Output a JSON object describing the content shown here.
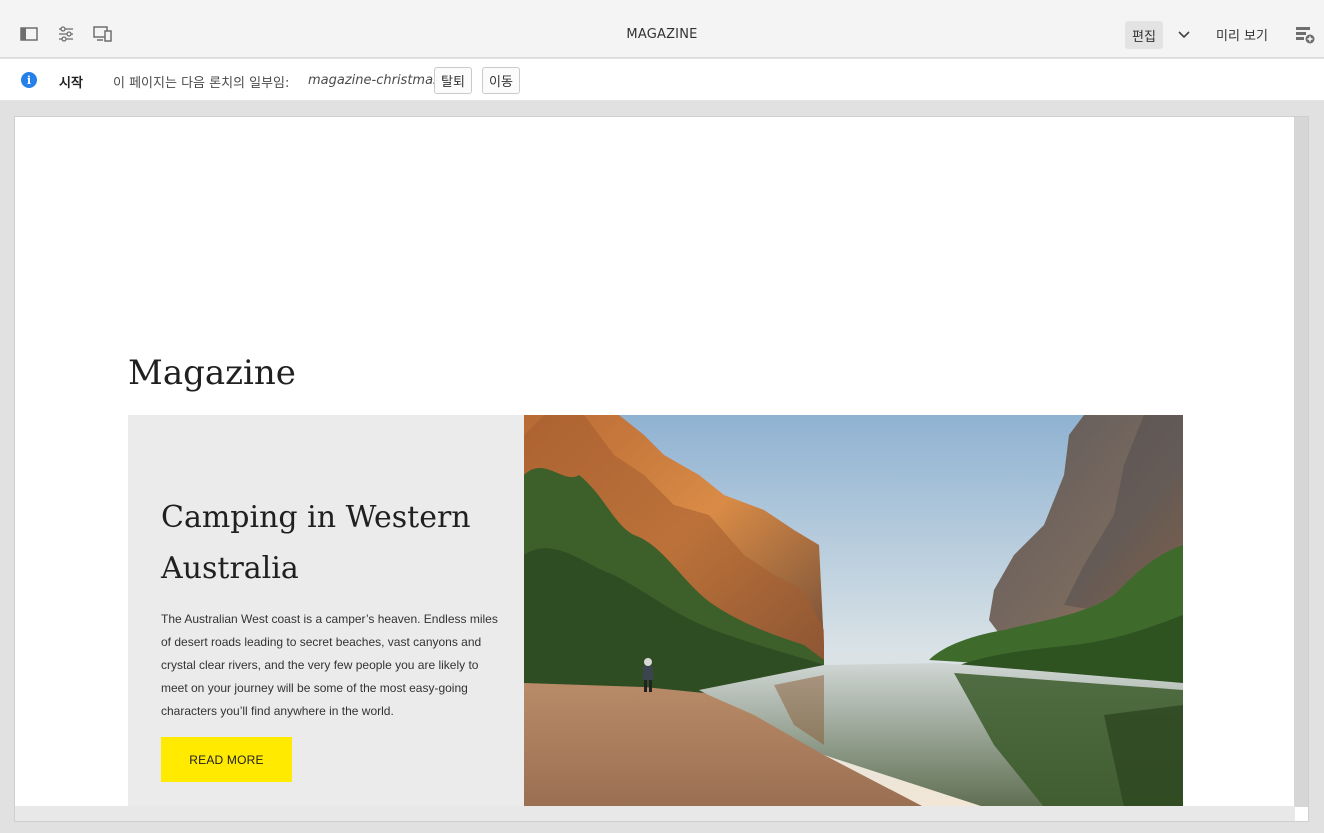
{
  "toolbar": {
    "title": "MAGAZINE",
    "edit_label": "편집",
    "preview_label": "미리 보기"
  },
  "infobar": {
    "start_label": "시작",
    "launch_text": "이 페이지는 다음 론치의 일부임:",
    "launch_name": "magazine-christmas",
    "detach_label": "탈퇴",
    "go_label": "이동"
  },
  "page": {
    "title": "Magazine",
    "teaser": {
      "title": "Camping in Western Australia",
      "description": "The Australian West coast is a camper’s heaven. Endless miles of desert roads leading to secret beaches, vast canyons and crystal clear rivers, and the very few people you are likely to meet on your journey will be some of the most easy-going characters you’ll find anywhere in the world.",
      "cta_label": "READ MORE"
    }
  },
  "colors": {
    "accent": "#2680eb",
    "cta_background": "#ffea00"
  }
}
